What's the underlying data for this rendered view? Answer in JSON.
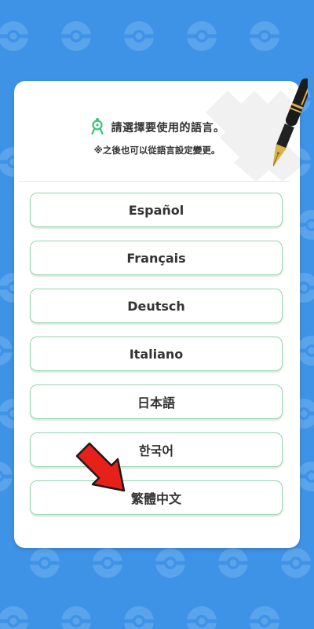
{
  "header": {
    "title": "請選擇要使用的語言。",
    "subtitle": "※之後也可以從語言設定變更。"
  },
  "languages": [
    "Español",
    "Français",
    "Deutsch",
    "Italiano",
    "日本語",
    "한국어",
    "繁體中文"
  ],
  "icons": {
    "title_icon": "compass-icon",
    "decoration": "fountain-pen-icon",
    "pointer": "red-arrow-icon",
    "background": "pokeball-pattern"
  },
  "colors": {
    "background": "#3f93e6",
    "card": "#ffffff",
    "button_border": "#8fd7ae",
    "accent_green": "#3cc07a",
    "arrow": "#e8201a"
  }
}
